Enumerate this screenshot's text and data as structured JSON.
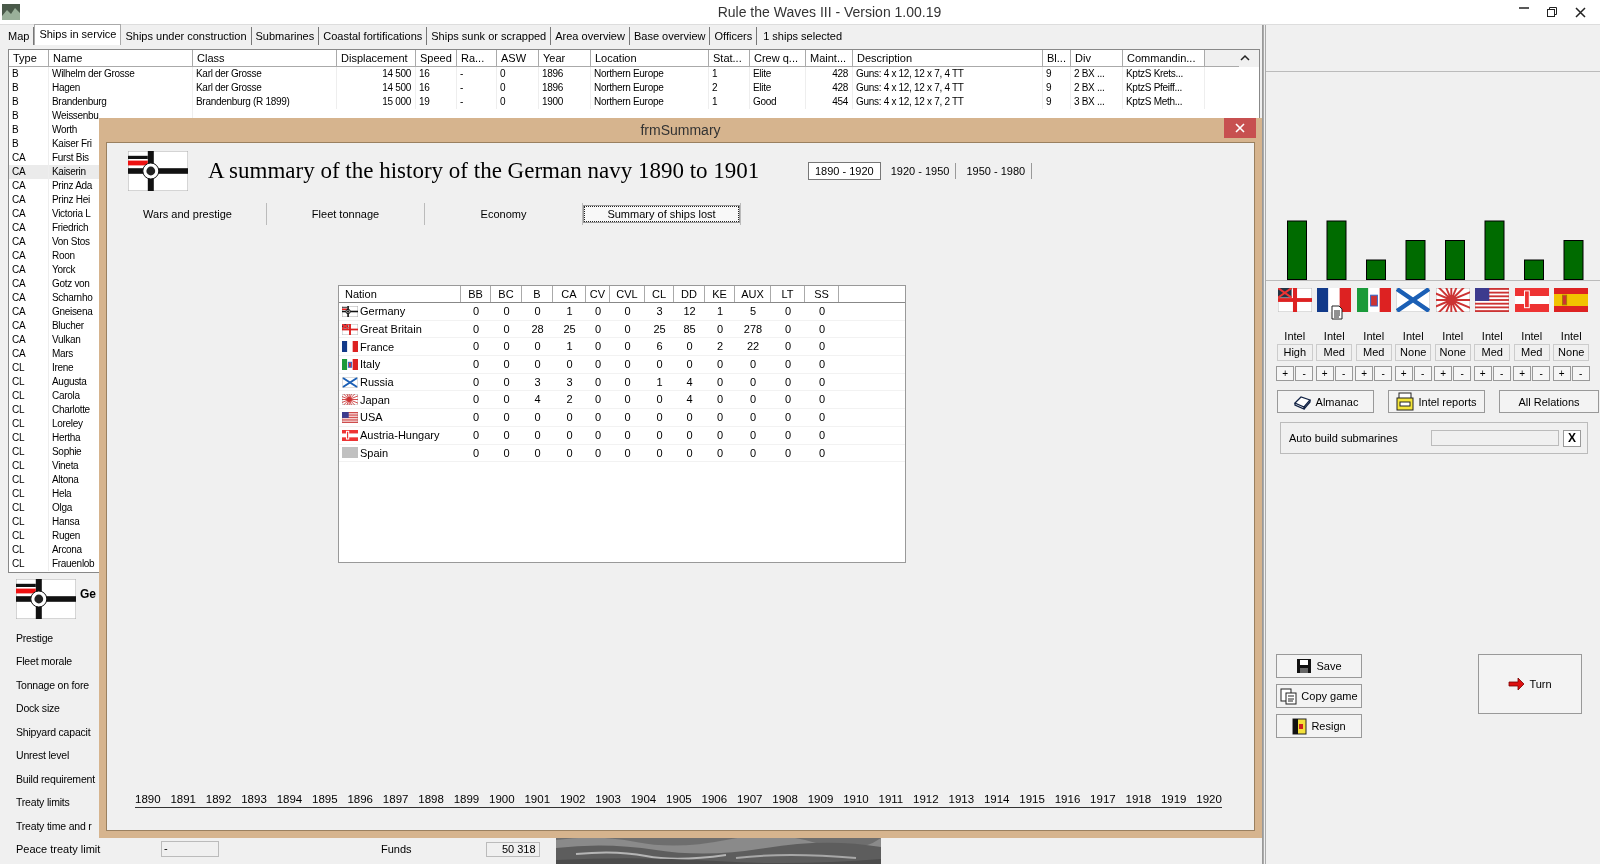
{
  "window": {
    "title": "Rule the Waves III - Version 1.00.19"
  },
  "tabs": [
    {
      "label": "Map",
      "selected": false
    },
    {
      "label": "Ships in service",
      "selected": true
    },
    {
      "label": "Ships under construction",
      "selected": false
    },
    {
      "label": "Submarines",
      "selected": false
    },
    {
      "label": "Coastal fortifications",
      "selected": false
    },
    {
      "label": "Ships sunk or scrapped",
      "selected": false
    },
    {
      "label": "Area overview",
      "selected": false
    },
    {
      "label": "Base overview",
      "selected": false
    },
    {
      "label": "Officers",
      "selected": false
    }
  ],
  "selection_note": "1 ships selected",
  "ship_table": {
    "columns": [
      "Type",
      "Name",
      "Class",
      "Displacement",
      "Speed",
      "Ra...",
      "ASW",
      "Year",
      "Location",
      "Stat...",
      "Crew q...",
      "Maint...",
      "Description",
      "Bl...",
      "Div",
      "Commandin..."
    ],
    "rows": [
      {
        "selected": false,
        "cells": [
          "B",
          "Wilhelm der Grosse",
          "Karl der Grosse",
          "14 500",
          "16",
          "-",
          "0",
          "1896",
          "Northern Europe",
          "1",
          "Elite",
          "428",
          "Guns: 4 x 12, 12 x 7, 4 TT",
          "9",
          "2 BX ...",
          "KptzS Krets..."
        ]
      },
      {
        "selected": false,
        "cells": [
          "B",
          "Hagen",
          "Karl der Grosse",
          "14 500",
          "16",
          "-",
          "0",
          "1896",
          "Northern Europe",
          "2",
          "Elite",
          "428",
          "Guns: 4 x 12, 12 x 7, 4 TT",
          "9",
          "2 BX ...",
          "KptzS Pfeiff..."
        ]
      },
      {
        "selected": false,
        "cells": [
          "B",
          "Brandenburg",
          "Brandenburg (R 1899)",
          "15 000",
          "19",
          "-",
          "0",
          "1900",
          "Northern Europe",
          "1",
          "Good",
          "454",
          "Guns: 4 x 12, 12 x 7, 2 TT",
          "9",
          "3 BX ...",
          "KptzS Meth..."
        ]
      },
      {
        "selected": false,
        "cells": [
          "B",
          "Weissenbu"
        ]
      },
      {
        "selected": false,
        "cells": [
          "B",
          "Worth"
        ]
      },
      {
        "selected": false,
        "cells": [
          "B",
          "Kaiser Fri"
        ]
      },
      {
        "selected": false,
        "cells": [
          "CA",
          "Furst Bis"
        ]
      },
      {
        "selected": true,
        "cells": [
          "CA",
          "Kaiserin"
        ]
      },
      {
        "selected": false,
        "cells": [
          "CA",
          "Prinz Ada"
        ]
      },
      {
        "selected": false,
        "cells": [
          "CA",
          "Prinz Hei"
        ]
      },
      {
        "selected": false,
        "cells": [
          "CA",
          "Victoria L"
        ]
      },
      {
        "selected": false,
        "cells": [
          "CA",
          "Friedrich"
        ]
      },
      {
        "selected": false,
        "cells": [
          "CA",
          "Von Stos"
        ]
      },
      {
        "selected": false,
        "cells": [
          "CA",
          "Roon"
        ]
      },
      {
        "selected": false,
        "cells": [
          "CA",
          "Yorck"
        ]
      },
      {
        "selected": false,
        "cells": [
          "CA",
          "Gotz von"
        ]
      },
      {
        "selected": false,
        "cells": [
          "CA",
          "Scharnho"
        ]
      },
      {
        "selected": false,
        "cells": [
          "CA",
          "Gneisena"
        ]
      },
      {
        "selected": false,
        "cells": [
          "CA",
          "Blucher"
        ]
      },
      {
        "selected": false,
        "cells": [
          "CA",
          "Vulkan"
        ]
      },
      {
        "selected": false,
        "cells": [
          "CA",
          "Mars"
        ]
      },
      {
        "selected": false,
        "cells": [
          "CL",
          "Irene"
        ]
      },
      {
        "selected": false,
        "cells": [
          "CL",
          "Augusta"
        ]
      },
      {
        "selected": false,
        "cells": [
          "CL",
          "Carola"
        ]
      },
      {
        "selected": false,
        "cells": [
          "CL",
          "Charlotte"
        ]
      },
      {
        "selected": false,
        "cells": [
          "CL",
          "Loreley"
        ]
      },
      {
        "selected": false,
        "cells": [
          "CL",
          "Hertha"
        ]
      },
      {
        "selected": false,
        "cells": [
          "CL",
          "Sophie"
        ]
      },
      {
        "selected": false,
        "cells": [
          "CL",
          "Vineta"
        ]
      },
      {
        "selected": false,
        "cells": [
          "CL",
          "Altona"
        ]
      },
      {
        "selected": false,
        "cells": [
          "CL",
          "Hela"
        ]
      },
      {
        "selected": false,
        "cells": [
          "CL",
          "Olga"
        ]
      },
      {
        "selected": false,
        "cells": [
          "CL",
          "Hansa"
        ]
      },
      {
        "selected": false,
        "cells": [
          "CL",
          "Rugen"
        ]
      },
      {
        "selected": false,
        "cells": [
          "CL",
          "Arcona"
        ]
      },
      {
        "selected": false,
        "cells": [
          "CL",
          "Frauenlob"
        ]
      }
    ]
  },
  "country": {
    "kind": "germany",
    "name": "Ge",
    "rows": [
      {
        "label": "Prestige"
      },
      {
        "label": "Fleet morale"
      },
      {
        "label": "Tonnage on fore"
      },
      {
        "label": "Dock size"
      },
      {
        "label": "Shipyard capacit"
      },
      {
        "label": "Unrest level"
      },
      {
        "label": "Build requirement"
      },
      {
        "label": "Treaty limits"
      },
      {
        "label": "Treaty time and r"
      }
    ],
    "peace_label": "Peace treaty limit",
    "peace_value": "-",
    "funds_label": "Funds",
    "funds_value": "50 318"
  },
  "nation_panel": {
    "nations": [
      {
        "kind": "britain",
        "report": false,
        "intel_label": "Intel",
        "intel": "High",
        "plus": "+",
        "minus": "-"
      },
      {
        "kind": "france",
        "report": true,
        "intel_label": "Intel",
        "intel": "Med",
        "plus": "+",
        "minus": "-"
      },
      {
        "kind": "italy",
        "report": false,
        "intel_label": "Intel",
        "intel": "Med",
        "plus": "+",
        "minus": "-"
      },
      {
        "kind": "russia",
        "report": false,
        "intel_label": "Intel",
        "intel": "None",
        "plus": "+",
        "minus": "-"
      },
      {
        "kind": "japan",
        "report": false,
        "intel_label": "Intel",
        "intel": "None",
        "plus": "+",
        "minus": "-"
      },
      {
        "kind": "usa",
        "report": false,
        "intel_label": "Intel",
        "intel": "Med",
        "plus": "+",
        "minus": "-"
      },
      {
        "kind": "austria",
        "report": false,
        "intel_label": "Intel",
        "intel": "Med",
        "plus": "+",
        "minus": "-"
      },
      {
        "kind": "spain",
        "report": false,
        "intel_label": "Intel",
        "intel": "None",
        "plus": "+",
        "minus": "-"
      }
    ],
    "buttons": [
      {
        "label": "Almanac",
        "kind": "book"
      },
      {
        "label": "Intel reports",
        "kind": "printer"
      },
      {
        "label": "All Relations",
        "kind": "plain"
      }
    ],
    "auto_build": {
      "label": "Auto build submarines",
      "clear": "X"
    }
  },
  "actions": [
    {
      "label": "Save",
      "kind": "disk"
    },
    {
      "label": "Copy game",
      "kind": "copy"
    },
    {
      "label": "Resign",
      "kind": "resign"
    }
  ],
  "turn": {
    "label": "Turn"
  },
  "summary": {
    "title": "frmSummary",
    "kind": "germany",
    "heading": "A summary of the history of the German navy 1890 to 1901",
    "periods": [
      {
        "label": "1890 - 1920",
        "selected": true
      },
      {
        "label": "1920 - 1950",
        "selected": false
      },
      {
        "label": "1950 - 1980",
        "selected": false
      }
    ],
    "views": [
      {
        "label": "Wars and prestige",
        "selected": false
      },
      {
        "label": "Fleet tonnage",
        "selected": false
      },
      {
        "label": "Economy",
        "selected": false
      },
      {
        "label": "Summary of ships lost",
        "selected": true
      }
    ],
    "losses": {
      "columns": [
        "Nation",
        "BB",
        "BC",
        "B",
        "CA",
        "CV",
        "CVL",
        "CL",
        "DD",
        "KE",
        "AUX",
        "LT",
        "SS"
      ],
      "rows": [
        {
          "kind": "germany",
          "nation": "Germany",
          "values": [
            "0",
            "0",
            "0",
            "1",
            "0",
            "0",
            "3",
            "12",
            "1",
            "5",
            "0",
            "0"
          ]
        },
        {
          "kind": "britain",
          "nation": "Great Britain",
          "values": [
            "0",
            "0",
            "28",
            "25",
            "0",
            "0",
            "25",
            "85",
            "0",
            "278",
            "0",
            "0"
          ]
        },
        {
          "kind": "france",
          "nation": "France",
          "values": [
            "0",
            "0",
            "0",
            "1",
            "0",
            "0",
            "6",
            "0",
            "2",
            "22",
            "0",
            "0"
          ]
        },
        {
          "kind": "italy",
          "nation": "Italy",
          "values": [
            "0",
            "0",
            "0",
            "0",
            "0",
            "0",
            "0",
            "0",
            "0",
            "0",
            "0",
            "0"
          ]
        },
        {
          "kind": "russia",
          "nation": "Russia",
          "values": [
            "0",
            "0",
            "3",
            "3",
            "0",
            "0",
            "1",
            "4",
            "0",
            "0",
            "0",
            "0"
          ]
        },
        {
          "kind": "japan",
          "nation": "Japan",
          "values": [
            "0",
            "0",
            "4",
            "2",
            "0",
            "0",
            "0",
            "4",
            "0",
            "0",
            "0",
            "0"
          ]
        },
        {
          "kind": "usa",
          "nation": "USA",
          "values": [
            "0",
            "0",
            "0",
            "0",
            "0",
            "0",
            "0",
            "0",
            "0",
            "0",
            "0",
            "0"
          ]
        },
        {
          "kind": "austria",
          "nation": "Austria-Hungary",
          "values": [
            "0",
            "0",
            "0",
            "0",
            "0",
            "0",
            "0",
            "0",
            "0",
            "0",
            "0",
            "0"
          ]
        },
        {
          "kind": "blank",
          "nation": "Spain",
          "values": [
            "0",
            "0",
            "0",
            "0",
            "0",
            "0",
            "0",
            "0",
            "0",
            "0",
            "0",
            "0"
          ]
        }
      ]
    },
    "years": [
      "1890",
      "1891",
      "1892",
      "1893",
      "1894",
      "1895",
      "1896",
      "1897",
      "1898",
      "1899",
      "1900",
      "1901",
      "1902",
      "1903",
      "1904",
      "1905",
      "1906",
      "1907",
      "1908",
      "1909",
      "1910",
      "1911",
      "1912",
      "1913",
      "1914",
      "1915",
      "1916",
      "1917",
      "1918",
      "1919",
      "1920"
    ]
  }
}
